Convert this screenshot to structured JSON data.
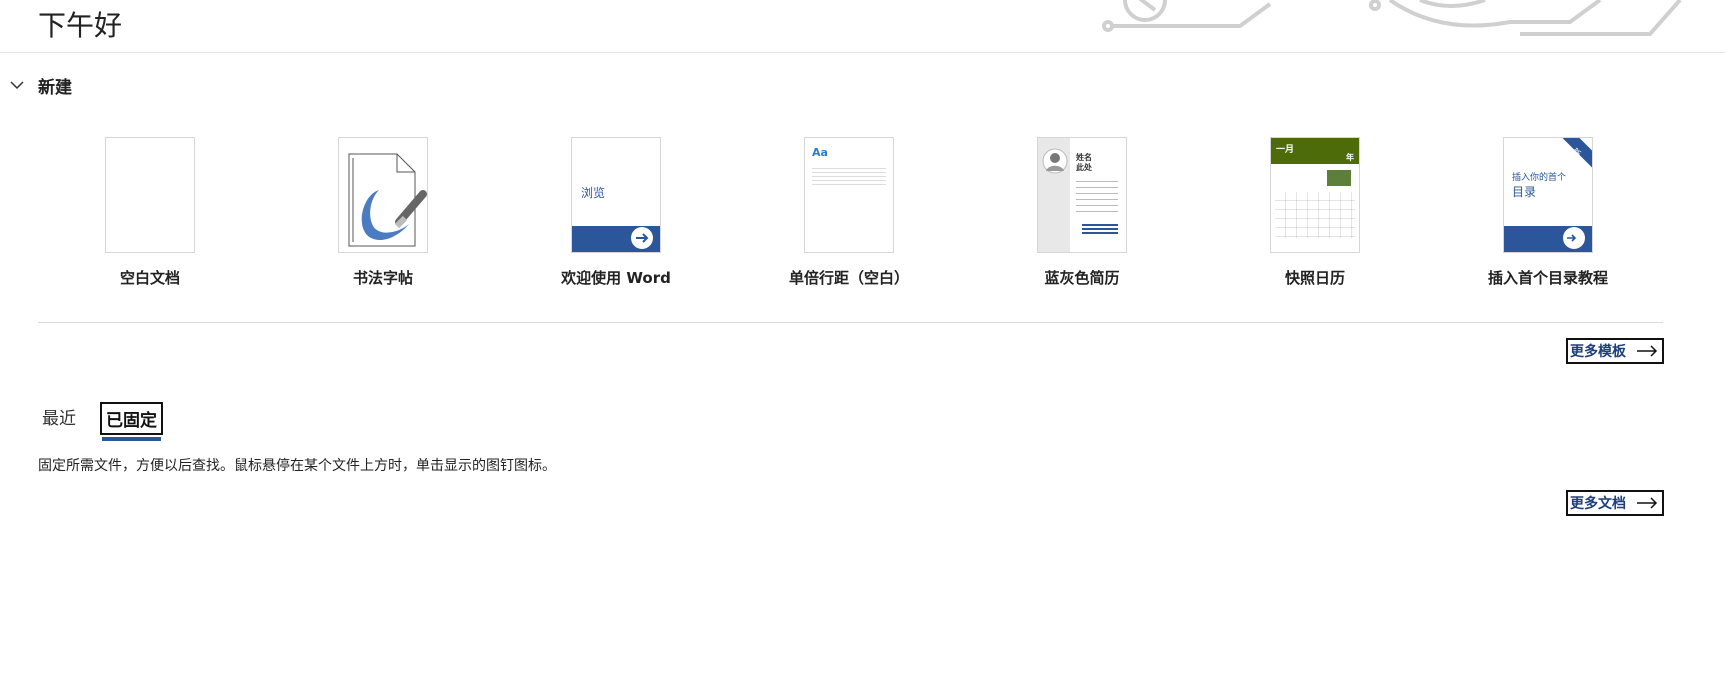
{
  "greeting": "下午好",
  "new_section": {
    "title": "新建"
  },
  "templates": [
    {
      "label": "空白文档"
    },
    {
      "label": "书法字帖"
    },
    {
      "label": "欢迎使用 Word",
      "thumb_text": "浏览"
    },
    {
      "label": "单倍行距（空白）",
      "thumb_text": "Aa"
    },
    {
      "label": "蓝灰色简历",
      "thumb_text": [
        "姓名",
        "此处"
      ]
    },
    {
      "label": "快照日历",
      "thumb_text": [
        "一月",
        "年"
      ]
    },
    {
      "label": "插入首个目录教程",
      "thumb_text": [
        "插入你的首个",
        "目录"
      ],
      "badge": "新"
    }
  ],
  "more_templates": "更多模板",
  "tabs": {
    "recent": "最近",
    "pinned": "已固定"
  },
  "pinned_hint": "固定所需文件，方便以后查找。鼠标悬停在某个文件上方时，单击显示的图钉图标。",
  "more_documents": "更多文档",
  "colors": {
    "accent": "#2b579a",
    "link": "#1e3f7a",
    "calendar_green": "#4e6b0a"
  },
  "icons": [
    "chevron-down-icon",
    "arrow-right-icon",
    "circuit-decoration"
  ]
}
